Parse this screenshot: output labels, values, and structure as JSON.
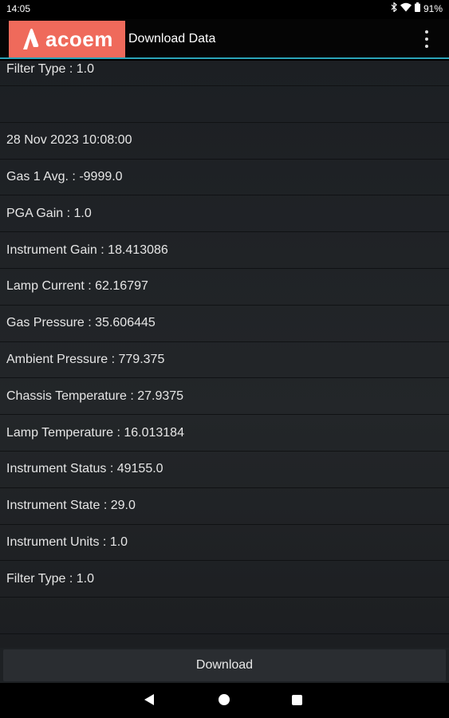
{
  "status_bar": {
    "time": "14:05",
    "battery": "91%",
    "icons": [
      "bluetooth-icon",
      "wifi-icon",
      "battery-icon"
    ]
  },
  "app_bar": {
    "logo_text": "acoem",
    "title": "Download Data",
    "accent_color": "#ef6a5b",
    "divider_color": "#2aa3b8"
  },
  "rows": [
    "Filter Type : 1.0",
    "",
    "28 Nov 2023 10:08:00",
    "Gas 1 Avg. : -9999.0",
    "PGA Gain : 1.0",
    "Instrument Gain : 18.413086",
    "Lamp Current : 62.16797",
    "Gas Pressure : 35.606445",
    "Ambient Pressure : 779.375",
    "Chassis Temperature : 27.9375",
    "Lamp Temperature : 16.013184",
    "Instrument Status : 49155.0",
    "Instrument State : 29.0",
    "Instrument Units : 1.0",
    "Filter Type : 1.0",
    "",
    ""
  ],
  "download_button": "Download"
}
